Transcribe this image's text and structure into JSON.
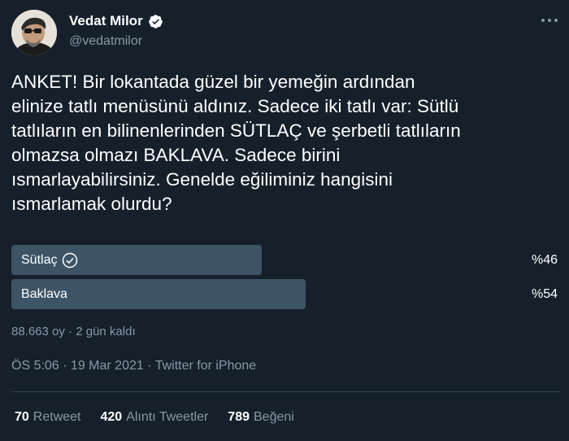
{
  "author": {
    "name": "Vedat Milor",
    "handle": "@vedatmilor",
    "verified": true
  },
  "tweet": {
    "text": "ANKET! Bir lokantada güzel bir yemeğin ardından\nelinize tatlı menüsünü aldınız. Sadece iki tatlı var: Sütlü\ntatlıların en bilinenlerinden SÜTLAÇ ve şerbetli tatlıların\nolmazsa olmazı BAKLAVA. Sadece birini\nısmarlayabilirsiniz. Genelde eğiliminiz hangisini\nısmarlamak olurdu?"
  },
  "poll": {
    "options": [
      {
        "label": "Sütlaç",
        "percent_text": "%46",
        "percent": 46,
        "selected": true
      },
      {
        "label": "Baklava",
        "percent_text": "%54",
        "percent": 54,
        "selected": false
      }
    ],
    "meta": "88.663 oy · 2 gün kaldı"
  },
  "timestamp": "ÖS 5:06 · 19 Mar 2021 · Twitter for iPhone",
  "stats": {
    "retweets": {
      "count": "70",
      "label": "Retweet"
    },
    "quotes": {
      "count": "420",
      "label": "Alıntı Tweetler"
    },
    "likes": {
      "count": "789",
      "label": "Beğeni"
    }
  },
  "colors": {
    "background": "#15202b",
    "poll_bar": "#3d5466",
    "secondary_text": "#8899a6",
    "divider": "#38444d"
  },
  "icons": {
    "verified": "verified-badge-icon",
    "selected": "check-circle-icon",
    "more": "more-dots-icon"
  }
}
